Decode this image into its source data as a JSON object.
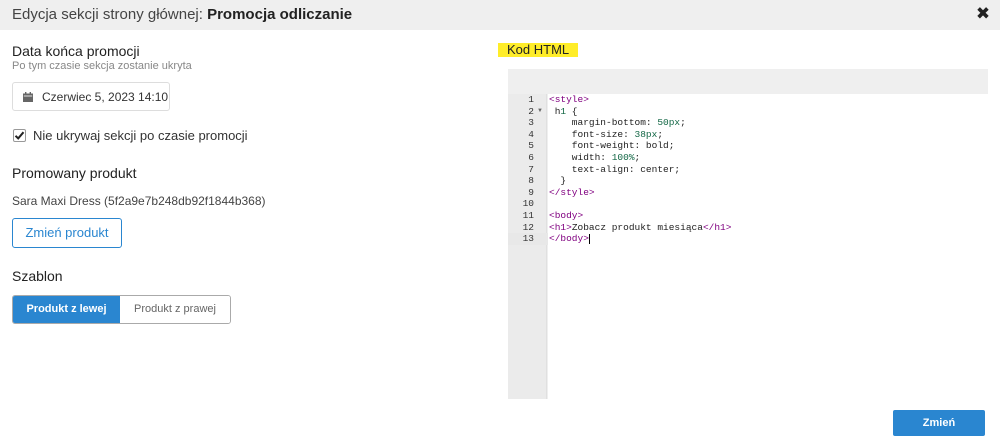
{
  "dialog": {
    "title_prefix": "Edycja sekcji strony głównej: ",
    "title_name": "Promocja odliczanie",
    "close_icon": "✖"
  },
  "end_date": {
    "label": "Data końca promocji",
    "hint": "Po tym czasie sekcja zostanie ukryta",
    "value": "Czerwiec 5, 2023 14:10",
    "icon": "calendar-icon"
  },
  "hide_checkbox": {
    "label": "Nie ukrywaj sekcji po czasie promocji",
    "checked": true
  },
  "product": {
    "label": "Promowany produkt",
    "name": "Sara Maxi Dress (5f2a9e7b248db92f1844b368)",
    "change_button": "Zmień produkt"
  },
  "template": {
    "label": "Szablon",
    "options": [
      "Produkt z lewej",
      "Produkt z prawej"
    ],
    "selected": "Produkt z lewej"
  },
  "code": {
    "label": "Kod HTML",
    "active_line": 13,
    "line_numbers": [
      "1",
      "2",
      "3",
      "4",
      "5",
      "6",
      "7",
      "8",
      "9",
      "10",
      "11",
      "12",
      "13"
    ],
    "lines": [
      "<style>",
      " h1 {",
      "    margin-bottom: 50px;",
      "    font-size: 38px;",
      "    font-weight: bold;",
      "    width: 100%;",
      "    text-align: center;",
      "  }",
      "</style>",
      "",
      "<body>",
      "<h1>Zobacz produkt miesiąca</h1>",
      "</body>"
    ]
  },
  "footer": {
    "save_button": "Zmień"
  },
  "colors": {
    "accent": "#2a86d0",
    "highlight": "#ffed29",
    "tag": "#800080",
    "number": "#116644"
  }
}
